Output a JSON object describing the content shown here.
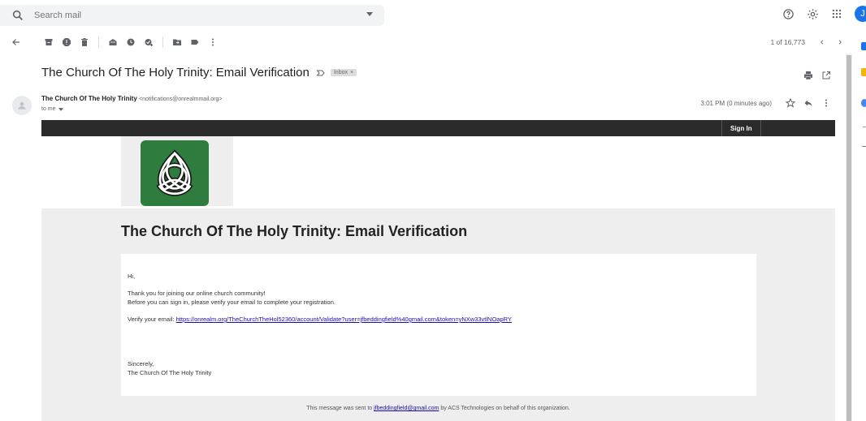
{
  "search": {
    "placeholder": "Search mail"
  },
  "toolbar": {
    "back": "arrow-left-icon",
    "pager": {
      "count": "1 of 16,773"
    }
  },
  "header": {
    "avatar_initial": "J"
  },
  "message": {
    "subject": "The Church Of The Holy Trinity: Email Verification",
    "label_chip": "Inbox",
    "label_chip_close": "×",
    "sender_name": "The Church Of The Holy Trinity",
    "sender_address": "<notifications@onrealmmail.org>",
    "to": "to me",
    "time": "3:01 PM (0 minutes ago)"
  },
  "email": {
    "sign_in": "Sign In",
    "title": "The Church Of The Holy Trinity: Email Verification",
    "greeting": "Hi,",
    "line1": "Thank you for joining our online church community!",
    "line2": "Before you can sign in, please verify your email to complete your registration.",
    "verify_label": "Verify your email: ",
    "verify_link": "https://onrealm.org/TheChurchTheHol52360/account/Validate?user=jfbeddingfield%40gmail.com&token=yNXw33vtlNOapRY",
    "signoff": "Sincerely,",
    "signature": "The Church Of The Holy Trinity",
    "footer_prefix": "This message was sent to ",
    "footer_email": "jfbeddingfield@gmail.com",
    "footer_suffix": " by ACS Technologies on behalf of this organization."
  },
  "colors": {
    "accent": "#1a73e8",
    "logo_green": "#2e7d3f",
    "dark_bar": "#2b2b2b"
  }
}
